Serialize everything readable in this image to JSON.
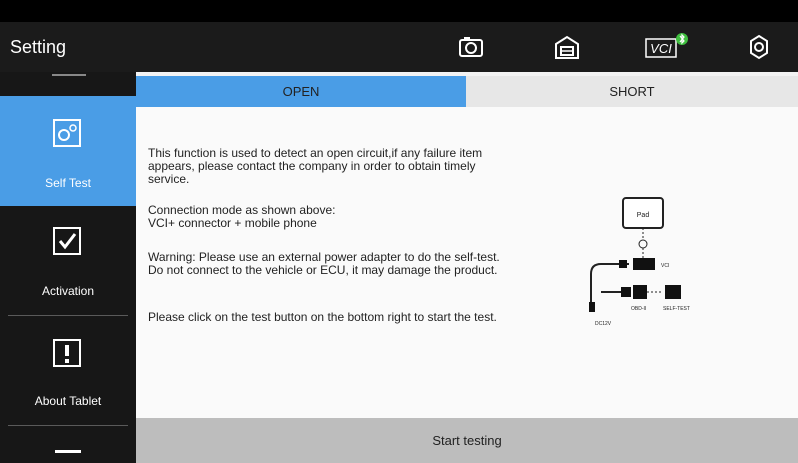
{
  "header": {
    "title": "Setting",
    "icons": [
      "camera-icon",
      "garage-icon",
      "vci-icon",
      "settings-icon"
    ],
    "vci_label": "VCI"
  },
  "sidebar": {
    "items": [
      {
        "label": "Self Test",
        "icon": "self-test-icon",
        "selected": true
      },
      {
        "label": "Activation",
        "icon": "activation-icon",
        "selected": false
      },
      {
        "label": "About Tablet",
        "icon": "about-icon",
        "selected": false
      }
    ]
  },
  "tabs": [
    {
      "label": "OPEN",
      "active": true
    },
    {
      "label": "SHORT",
      "active": false
    }
  ],
  "content": {
    "para1": "  This function is used to detect an open circuit,if any failure item appears, please contact the company in order to obtain timely service.",
    "para2": "Connection mode as shown above:\nVCI+ connector + mobile phone",
    "para3": "  Warning: Please use an external power adapter to do the self-test. Do not connect to the vehicle or ECU, it may damage the product.",
    "para4": "  Please click on the test button on the bottom right to start the test."
  },
  "diagram": {
    "pad_label": "Pad",
    "vci_label": "VCI",
    "dc_label": "DC12V",
    "obd_label": "OBD-II",
    "selftest_label": "SELF-TEST"
  },
  "footer": {
    "button_label": "Start testing"
  },
  "colors": {
    "accent": "#4a9de6",
    "topbar": "#1b1b1b",
    "sidebar": "#171717",
    "footer": "#bdbdbd"
  }
}
